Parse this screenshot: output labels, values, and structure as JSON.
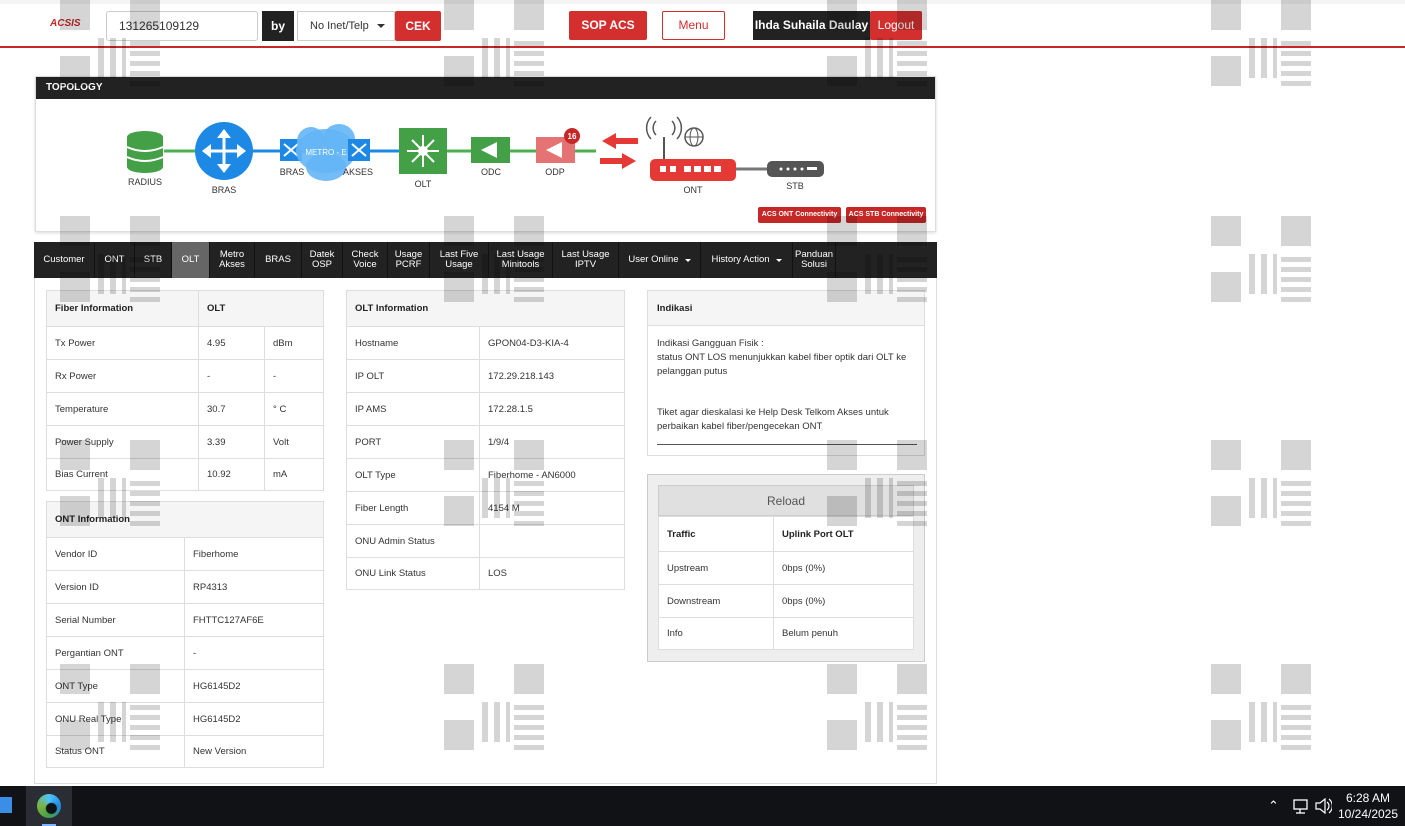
{
  "header": {
    "logo": "ACSIS",
    "search_value": "131265109129",
    "by_label": "by",
    "search_type": "No Inet/Telp",
    "cek_label": "CEK",
    "sop_label": "SOP ACS",
    "menu_label": "Menu",
    "user_name": "Ihda Suhaila Daulay",
    "logout_label": "Logout"
  },
  "topology": {
    "title": "TOPOLOGY",
    "labels": {
      "radius": "RADIUS",
      "bras": "BRAS",
      "bras2": "BRAS",
      "metro": "METRO - E",
      "akses": "AKSES",
      "olt": "OLT",
      "odc": "ODC",
      "odp": "ODP",
      "ont": "ONT",
      "stb": "STB"
    },
    "odp_badge": "16",
    "acs_ont": "ACS ONT Connectivity",
    "acs_stb": "ACS STB Connectivity"
  },
  "tabs": [
    {
      "l1": "Customer",
      "l2": ""
    },
    {
      "l1": "ONT",
      "l2": ""
    },
    {
      "l1": "STB",
      "l2": ""
    },
    {
      "l1": "OLT",
      "l2": ""
    },
    {
      "l1": "Metro",
      "l2": "Akses"
    },
    {
      "l1": "BRAS",
      "l2": ""
    },
    {
      "l1": "Datek",
      "l2": "OSP"
    },
    {
      "l1": "Check",
      "l2": "Voice"
    },
    {
      "l1": "Usage",
      "l2": "PCRF"
    },
    {
      "l1": "Last Five",
      "l2": "Usage"
    },
    {
      "l1": "Last Usage",
      "l2": "Minitools"
    },
    {
      "l1": "Last Usage",
      "l2": "IPTV"
    },
    {
      "l1": "User Online",
      "l2": ""
    },
    {
      "l1": "History Action",
      "l2": ""
    },
    {
      "l1": "Panduan",
      "l2": "Solusi"
    }
  ],
  "fiber": {
    "header": [
      "Fiber Information",
      "OLT"
    ],
    "rows": [
      [
        "Tx Power",
        "4.95",
        "dBm"
      ],
      [
        "Rx Power",
        "-",
        "-"
      ],
      [
        "Temperature",
        "30.7",
        "° C"
      ],
      [
        "Power Supply",
        "3.39",
        "Volt"
      ],
      [
        "Bias Current",
        "10.92",
        "mA"
      ]
    ]
  },
  "ont": {
    "header": "ONT Information",
    "rows": [
      [
        "Vendor ID",
        "Fiberhome"
      ],
      [
        "Version ID",
        "RP4313"
      ],
      [
        "Serial Number",
        "FHTTC127AF6E"
      ],
      [
        "Pergantian ONT",
        "-"
      ],
      [
        "ONT Type",
        "HG6145D2"
      ],
      [
        "ONU Real Type",
        "HG6145D2"
      ],
      [
        "Status ONT",
        "New Version"
      ]
    ]
  },
  "olt": {
    "header": "OLT Information",
    "rows": [
      [
        "Hostname",
        "GPON04-D3-KIA-4"
      ],
      [
        "IP OLT",
        "172.29.218.143"
      ],
      [
        "IP AMS",
        "172.28.1.5"
      ],
      [
        "PORT",
        "1/9/4"
      ],
      [
        "OLT Type",
        "Fiberhome - AN6000"
      ],
      [
        "Fiber Length",
        "4154 M"
      ],
      [
        "ONU Admin Status",
        ""
      ],
      [
        "ONU Link Status",
        "LOS"
      ]
    ]
  },
  "indikasi": {
    "header": "Indikasi",
    "line1": "Indikasi Gangguan Fisik :",
    "line2": "status ONT LOS menunjukkan kabel fiber optik dari OLT ke pelanggan putus",
    "line3": "Tiket agar dieskalasi ke Help Desk Telkom Akses untuk perbaikan kabel fiber/pengecekan ONT"
  },
  "traffic": {
    "reload": "Reload",
    "header": [
      "Traffic",
      "Uplink Port OLT"
    ],
    "rows": [
      [
        "Upstream",
        "0bps (0%)"
      ],
      [
        "Downstream",
        "0bps (0%)"
      ],
      [
        "Info",
        "Belum penuh"
      ]
    ]
  },
  "taskbar": {
    "time": "6:28 AM",
    "date": "10/24/2025"
  }
}
